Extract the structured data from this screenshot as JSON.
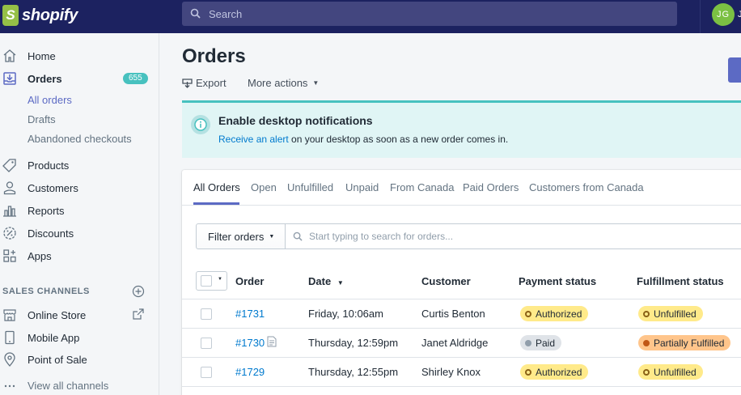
{
  "brand": {
    "name": "shopify",
    "bag_letter": "S"
  },
  "search": {
    "placeholder": "Search"
  },
  "user": {
    "initials": "JG",
    "trail": "J"
  },
  "sidebar": {
    "items": [
      {
        "label": "Home",
        "icon": "home-icon"
      },
      {
        "label": "Orders",
        "icon": "orders-icon",
        "badge": "655"
      },
      {
        "label": "Products",
        "icon": "tag-icon"
      },
      {
        "label": "Customers",
        "icon": "person-icon"
      },
      {
        "label": "Reports",
        "icon": "bar-chart-icon"
      },
      {
        "label": "Discounts",
        "icon": "discount-icon"
      },
      {
        "label": "Apps",
        "icon": "apps-icon"
      }
    ],
    "order_subitems": [
      "All orders",
      "Drafts",
      "Abandoned checkouts"
    ],
    "channels_title": "SALES CHANNELS",
    "channels": [
      {
        "label": "Online Store",
        "icon": "store-icon"
      },
      {
        "label": "Mobile App",
        "icon": "mobile-icon"
      },
      {
        "label": "Point of Sale",
        "icon": "location-icon"
      }
    ],
    "view_all": "View all channels"
  },
  "page": {
    "title": "Orders",
    "export_label": "Export",
    "more_actions_label": "More actions"
  },
  "banner": {
    "title": "Enable desktop notifications",
    "link_text": "Receive an alert",
    "text": " on your desktop as soon as a new order comes in."
  },
  "tabs": [
    "All Orders",
    "Open",
    "Unfulfilled",
    "Unpaid",
    "From Canada",
    "Paid Orders",
    "Customers from Canada"
  ],
  "filter": {
    "button_label": "Filter orders",
    "placeholder": "Start typing to search for orders..."
  },
  "table": {
    "headers": {
      "order": "Order",
      "date": "Date",
      "customer": "Customer",
      "payment": "Payment status",
      "fulfillment": "Fulfillment status"
    },
    "rows": [
      {
        "order": "#1731",
        "date": "Friday, 10:06am",
        "customer": "Curtis Benton",
        "payment": "Authorized",
        "fulfillment": "Unfulfilled",
        "note": false
      },
      {
        "order": "#1730",
        "date": "Thursday, 12:59pm",
        "customer": "Janet Aldridge",
        "payment": "Paid",
        "fulfillment": "Partially Fulfilled",
        "note": true
      },
      {
        "order": "#1729",
        "date": "Thursday, 12:55pm",
        "customer": "Shirley Knox",
        "payment": "Authorized",
        "fulfillment": "Unfulfilled",
        "note": false
      }
    ]
  },
  "colors": {
    "topbar": "#1c2260",
    "accent": "#5c6ac4",
    "link": "#007ace",
    "badge": "#47c1bf",
    "brand_green": "#95bf47"
  }
}
